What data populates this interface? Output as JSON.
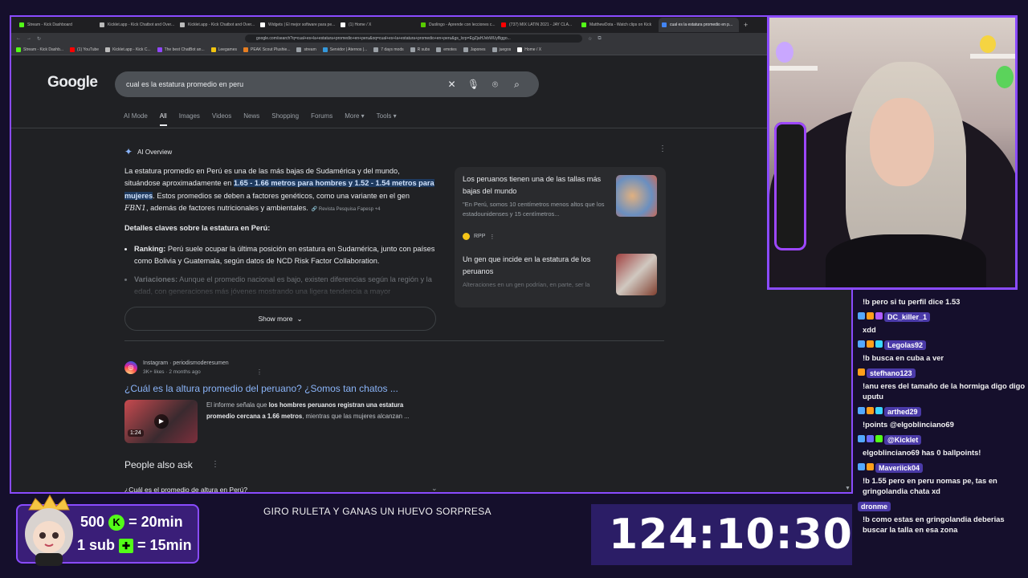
{
  "browser": {
    "tabs": [
      {
        "label": "Stream - Kick Dashboard",
        "color": "#53fc18"
      },
      {
        "label": "Kicklet.app - Kick Chatbot and Over...",
        "color": "#bbbbbb"
      },
      {
        "label": "Kicklet.app - Kick Chatbot and Over...",
        "color": "#bbbbbb"
      },
      {
        "label": "Widgets | El mejor software para pe...",
        "color": "#ffffff"
      },
      {
        "label": "(1) Home / X",
        "color": "#ffffff"
      },
      {
        "label": "Duolingo - Aprende con lecciones c...",
        "color": "#58cc02"
      },
      {
        "label": "(737) MIX LATIN 2021 - JAY CLA...",
        "color": "#ff0000"
      },
      {
        "label": "MatthewDota - Watch clips on Kick",
        "color": "#53fc18"
      },
      {
        "label": "cual es la estatura promedio en p...",
        "color": "#4285f4"
      }
    ],
    "new_tab": "+",
    "address": "google.com/search?q=cual+es+la+estatura+promedio+en+peru&oq=cual+es+la+estatura+promedio+en+peru&gs_lcrp=EgZjaHJvbWUyBggo...",
    "bookmarks": [
      {
        "label": "Stream - Kick Dashb...",
        "color": "#53fc18"
      },
      {
        "label": "(1) YouTube",
        "color": "#ff0000"
      },
      {
        "label": "Kicklet.app - Kick C...",
        "color": "#bbbbbb"
      },
      {
        "label": "The best ChatBot an...",
        "color": "#9146ff"
      },
      {
        "label": "Leegames",
        "color": "#f1c40f"
      },
      {
        "label": "PEAK Scout Plushie...",
        "color": "#e67e22"
      },
      {
        "label": "stream",
        "color": "#9aa0a6"
      },
      {
        "label": "Servidor | Aternos |...",
        "color": "#3498db"
      },
      {
        "label": "7 days mods",
        "color": "#9aa0a6"
      },
      {
        "label": "R subs",
        "color": "#9aa0a6"
      },
      {
        "label": "emotes",
        "color": "#9aa0a6"
      },
      {
        "label": "Japones",
        "color": "#9aa0a6"
      },
      {
        "label": "juegos",
        "color": "#9aa0a6"
      },
      {
        "label": "Home / X",
        "color": "#ffffff"
      }
    ]
  },
  "google": {
    "logo": "Google",
    "query": "cual es la estatura promedio en peru",
    "tabs": [
      "AI Mode",
      "All",
      "Images",
      "Videos",
      "News",
      "Shopping",
      "Forums",
      "More ▾",
      "Tools ▾"
    ],
    "ai": {
      "header": "AI Overview",
      "p_a": "La estatura promedio en Perú es una de las más bajas de Sudamérica y del mundo, situándose aproximadamente en ",
      "p_hl": "1.65 - 1.66 metros para hombres y 1.52 - 1.54 metros para mujeres",
      "p_b": ". Estos promedios se deben a factores genéticos, como una variante en el gen ",
      "p_gene": "FBN1",
      "p_c": ", además de factores nutricionales y ambientales.",
      "p_src": "Revista Pesquisa Fapesp +4",
      "sub": "Detalles claves sobre la estatura en Perú:",
      "items": [
        {
          "title": "Ranking:",
          "text": " Perú suele ocupar la última posición en estatura en Sudamérica, junto con países como Bolivia y Guatemala, según datos de NCD Risk Factor Collaboration."
        },
        {
          "title": "Variaciones:",
          "text": " Aunque el promedio nacional es bajo, existen diferencias según la región y la edad, con generaciones más jóvenes mostrando una ligera tendencia a mayor"
        }
      ],
      "show_more": "Show more"
    },
    "cards": [
      {
        "title": "Los peruanos tienen una de las tallas más bajas del mundo",
        "snippet": "\"En Perú, somos 10 centímetros menos altos que los estadounidenses y 15 centímetros...",
        "source": "RPP"
      },
      {
        "title": "Un gen que incide en la estatura de los peruanos",
        "snippet": "Alteraciones en un gen podrían, en parte, ser la"
      }
    ],
    "result": {
      "site": "Instagram · periodismoderesumen",
      "meta": "3K+ likes · 2 months ago",
      "title": "¿Cuál es la altura promedio del peruano? ¿Somos tan chatos ...",
      "duration": "1:24",
      "snippet_a": "El informe señala que ",
      "snippet_b": "los hombres peruanos registran una estatura promedio cercana a 1.66 metros",
      "snippet_c": ", mientras que las mujeres alcanzan ..."
    },
    "paa": {
      "title": "People also ask",
      "q1": "¿Cuál es el promedio de altura en Perú?"
    }
  },
  "chat": [
    {
      "user": "",
      "text": "!b pero si tu perfil dice 1.53",
      "badges": []
    },
    {
      "user": "DC_killer_1",
      "text": "xdd",
      "badges": [
        "#53a8ff",
        "#ff9f1a",
        "#b05cff"
      ]
    },
    {
      "user": "Legolas92",
      "text": "!b busca en cuba a ver",
      "badges": [
        "#53a8ff",
        "#ff9f1a",
        "#3ad6ff"
      ]
    },
    {
      "user": "stefhano123",
      "text": "!anu eres del tamaño de la hormiga digo digo uputu",
      "badges": [
        "#ff9f1a"
      ]
    },
    {
      "user": "arthed29",
      "text": "!points @elgoblinciano69",
      "badges": [
        "#53a8ff",
        "#ff9f1a",
        "#3ad6ff"
      ]
    },
    {
      "user": "@Kicklet",
      "text": "elgoblinciano69 has 0 ballpoints!",
      "badges": [
        "#53a8ff",
        "#6b6bff",
        "#53fc18"
      ]
    },
    {
      "user": "Maveriick04",
      "text": "!b 1.55 pero en peru nomas pe, tas en gringolandia chata xd",
      "badges": [
        "#53a8ff",
        "#ff9f1a"
      ]
    },
    {
      "user": "dronme",
      "text": "!b como estas en gringolandia deberias buscar la talla en esa zona",
      "badges": []
    }
  ],
  "overlay": {
    "promo_l1_a": "500",
    "promo_l1_b": "= 20min",
    "promo_l2_a": "1 sub",
    "promo_l2_b": "= 15min",
    "ticker": "GIRO RULETA Y GANAS UN HUEVO SORPRESA",
    "timer": "124:10:30",
    "accent": "#8a4bff",
    "kick_green": "#53fc18"
  }
}
